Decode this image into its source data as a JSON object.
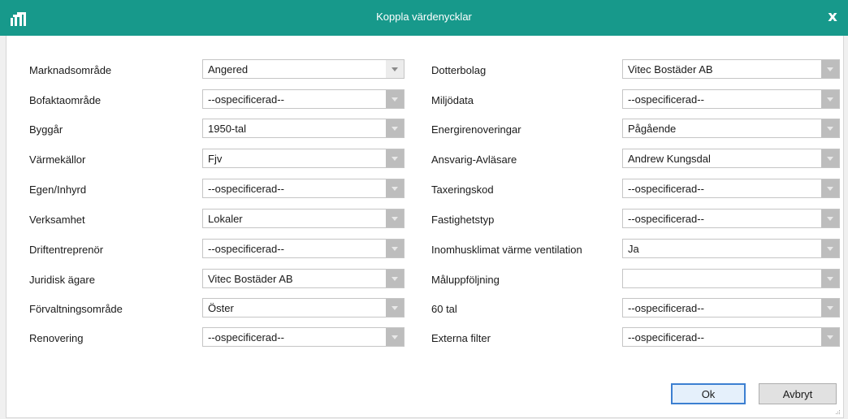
{
  "window": {
    "title": "Koppla värdenycklar",
    "close_glyph": "x",
    "app_icon": "bar-chart-logo-icon"
  },
  "colors": {
    "title_bar": "#17998b",
    "dropdown_arrow": "#bdbdbd",
    "default_button_border": "#3c7fd1"
  },
  "left_fields": [
    {
      "label": "Marknadsområde",
      "value": "Angered"
    },
    {
      "label": "Bofaktaområde",
      "value": "--ospecificerad--"
    },
    {
      "label": "Byggår",
      "value": "1950-tal"
    },
    {
      "label": "Värmekällor",
      "value": "Fjv"
    },
    {
      "label": "Egen/Inhyrd",
      "value": "--ospecificerad--"
    },
    {
      "label": "Verksamhet",
      "value": "Lokaler"
    },
    {
      "label": "Driftentreprenör",
      "value": "--ospecificerad--"
    },
    {
      "label": "Juridisk ägare",
      "value": "Vitec Bostäder AB"
    },
    {
      "label": "Förvaltningsområde",
      "value": "Öster"
    },
    {
      "label": "Renovering",
      "value": "--ospecificerad--"
    }
  ],
  "right_fields": [
    {
      "label": "Dotterbolag",
      "value": "Vitec Bostäder AB"
    },
    {
      "label": "Miljödata",
      "value": "--ospecificerad--"
    },
    {
      "label": "Energirenoveringar",
      "value": "Pågående"
    },
    {
      "label": "Ansvarig-Avläsare",
      "value": "Andrew Kungsdal"
    },
    {
      "label": "Taxeringskod",
      "value": "--ospecificerad--"
    },
    {
      "label": "Fastighetstyp",
      "value": "--ospecificerad--"
    },
    {
      "label": "Inomhusklimat värme ventilation",
      "value": "Ja"
    },
    {
      "label": "Måluppföljning",
      "value": ""
    },
    {
      "label": "60 tal",
      "value": "--ospecificerad--"
    },
    {
      "label": "Externa filter",
      "value": "--ospecificerad--"
    }
  ],
  "buttons": {
    "ok": "Ok",
    "cancel": "Avbryt"
  }
}
